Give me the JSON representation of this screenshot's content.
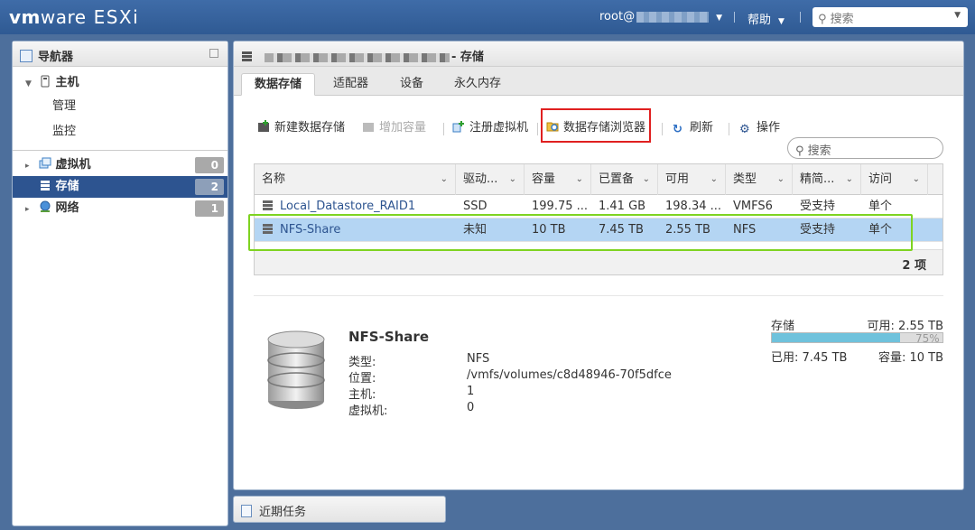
{
  "top": {
    "brand_bold": "vm",
    "brand_light": "ware",
    "brand_product": "ESXi",
    "user_label": "root@",
    "help_label": "帮助",
    "search_placeholder": "搜索"
  },
  "navigator": {
    "title": "导航器",
    "host": "主机",
    "host_children": [
      "管理",
      "监控"
    ],
    "items": [
      {
        "label": "虚拟机",
        "count": "0"
      },
      {
        "label": "存储",
        "count": "2"
      },
      {
        "label": "网络",
        "count": "1"
      }
    ]
  },
  "main": {
    "title_suffix": "- 存储",
    "tabs": [
      "数据存储",
      "适配器",
      "设备",
      "永久内存"
    ],
    "toolbar": {
      "new_datastore": "新建数据存储",
      "increase_capacity": "增加容量",
      "register_vm": "注册虚拟机",
      "datastore_browser": "数据存储浏览器",
      "refresh": "刷新",
      "actions": "操作"
    },
    "search_placeholder": "搜索",
    "table": {
      "columns": [
        "名称",
        "驱动...",
        "容量",
        "已置备",
        "可用",
        "类型",
        "精简...",
        "访问"
      ],
      "rows": [
        [
          "Local_Datastore_RAID1",
          "SSD",
          "199.75 ...",
          "1.41 GB",
          "198.34 ...",
          "VMFS6",
          "受支持",
          "单个"
        ],
        [
          "NFS-Share",
          "未知",
          "10 TB",
          "7.45 TB",
          "2.55 TB",
          "NFS",
          "受支持",
          "单个"
        ]
      ],
      "count": "2 项"
    },
    "details": {
      "name": "NFS-Share",
      "fields": [
        {
          "key": "类型:",
          "value": "NFS"
        },
        {
          "key": "位置:",
          "value": "/vmfs/volumes/c8d48946-70f5dfce"
        },
        {
          "key": "主机:",
          "value": "1"
        },
        {
          "key": "虚拟机:",
          "value": "0"
        }
      ],
      "storage_label": "存储",
      "free": "可用: 2.55 TB",
      "used_percent_text": "75%",
      "used_fraction": 0.75,
      "used": "已用: 7.45 TB",
      "capacity": "容量: 10 TB"
    }
  },
  "tasks": {
    "label": "近期任务"
  },
  "colors": {
    "accent": "#2d5490",
    "highlight_red": "#e02020",
    "highlight_green": "#7ed321",
    "bar_fill": "#6fc2dc"
  }
}
